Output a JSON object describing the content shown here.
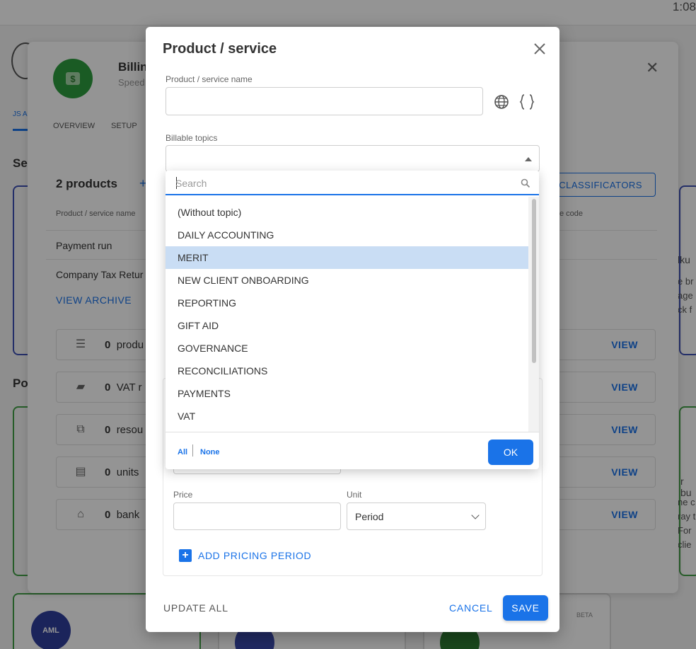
{
  "background": {
    "time": "1:08",
    "left_tab": "JS A",
    "left_section_1": "Se",
    "left_section_2": "Po",
    "aml_label": "AML",
    "beta_label": "BETA",
    "right_fragments": [
      "lku",
      "e br",
      "age",
      "ck f",
      "r bu",
      "ne c",
      "ray t",
      "For",
      "clie"
    ]
  },
  "panel": {
    "title": "Billin",
    "subtitle": "Speed",
    "tabs": [
      "OVERVIEW",
      "SETUP"
    ],
    "products_count": "2 products",
    "classificators_button": "CLASSIFICATORS",
    "column_name": "Product / service name",
    "column_code": "e code",
    "rows": [
      "Payment run",
      "Company Tax Retur"
    ],
    "view_archive": "VIEW ARCHIVE",
    "resources": [
      {
        "count": "0",
        "label": "produ",
        "icon": "list-icon",
        "glyph": "☰"
      },
      {
        "count": "0",
        "label": "VAT r",
        "icon": "briefcase-icon",
        "glyph": "▰"
      },
      {
        "count": "0",
        "label": "resou",
        "icon": "resource-icon",
        "glyph": "⧉"
      },
      {
        "count": "0",
        "label": "units",
        "icon": "archive-icon",
        "glyph": "▤"
      },
      {
        "count": "0",
        "label": "bank",
        "icon": "bank-icon",
        "glyph": "⌂"
      }
    ],
    "view_label": "VIEW"
  },
  "dialog": {
    "title": "Product / service",
    "name_label": "Product / service name",
    "name_value": "",
    "billable_label": "Billable topics",
    "price_label": "Price",
    "price_value": "",
    "unit_label": "Unit",
    "unit_value": "Period",
    "add_pricing_period": "ADD PRICING PERIOD",
    "update_all": "UPDATE ALL",
    "cancel": "CANCEL",
    "save": "SAVE"
  },
  "dropdown": {
    "search_placeholder": "Search",
    "items": [
      "(Without topic)",
      "DAILY ACCOUNTING",
      "MERIT",
      "NEW CLIENT ONBOARDING",
      "REPORTING",
      "GIFT AID",
      "GOVERNANCE",
      "RECONCILIATIONS",
      "PAYMENTS",
      "VAT"
    ],
    "selected_item": "MERIT",
    "all": "All",
    "none": "None",
    "ok": "OK"
  },
  "colors": {
    "accent": "#1a73e8",
    "selected_row": "#c9ddf4",
    "billing_icon": "#2e9e3e"
  }
}
